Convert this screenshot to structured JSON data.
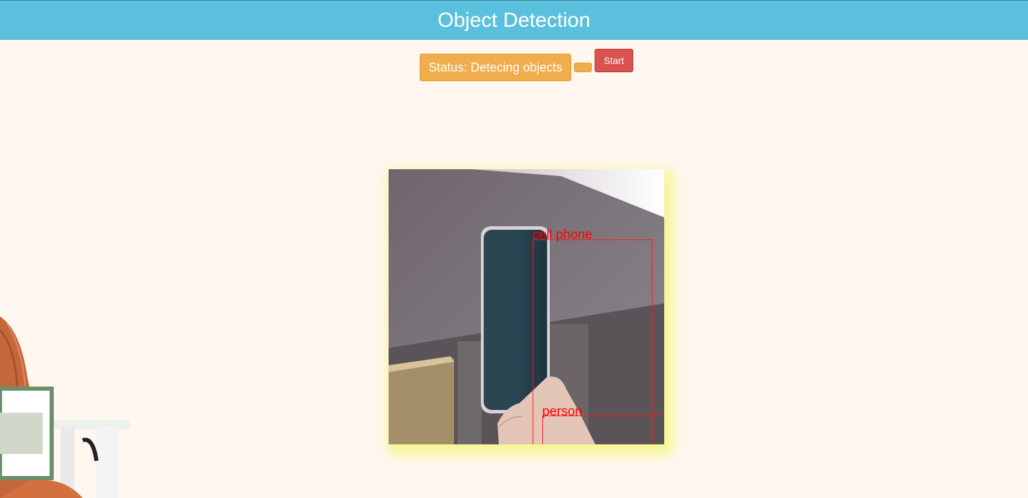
{
  "header": {
    "title": "Object Detection"
  },
  "controls": {
    "status_label": "Status: Detecing objects",
    "blank_button_label": "",
    "start_label": "Start"
  },
  "video": {
    "detections": [
      {
        "label": "cell phone"
      },
      {
        "label": "person"
      }
    ]
  },
  "colors": {
    "header_bg": "#5bc0de",
    "status_bg": "#f0ad4e",
    "start_bg": "#d9534f",
    "detection": "#ff0000",
    "page_bg": "#fff7f0"
  },
  "icons": {
    "decoration": "chair-with-blanket-image"
  }
}
